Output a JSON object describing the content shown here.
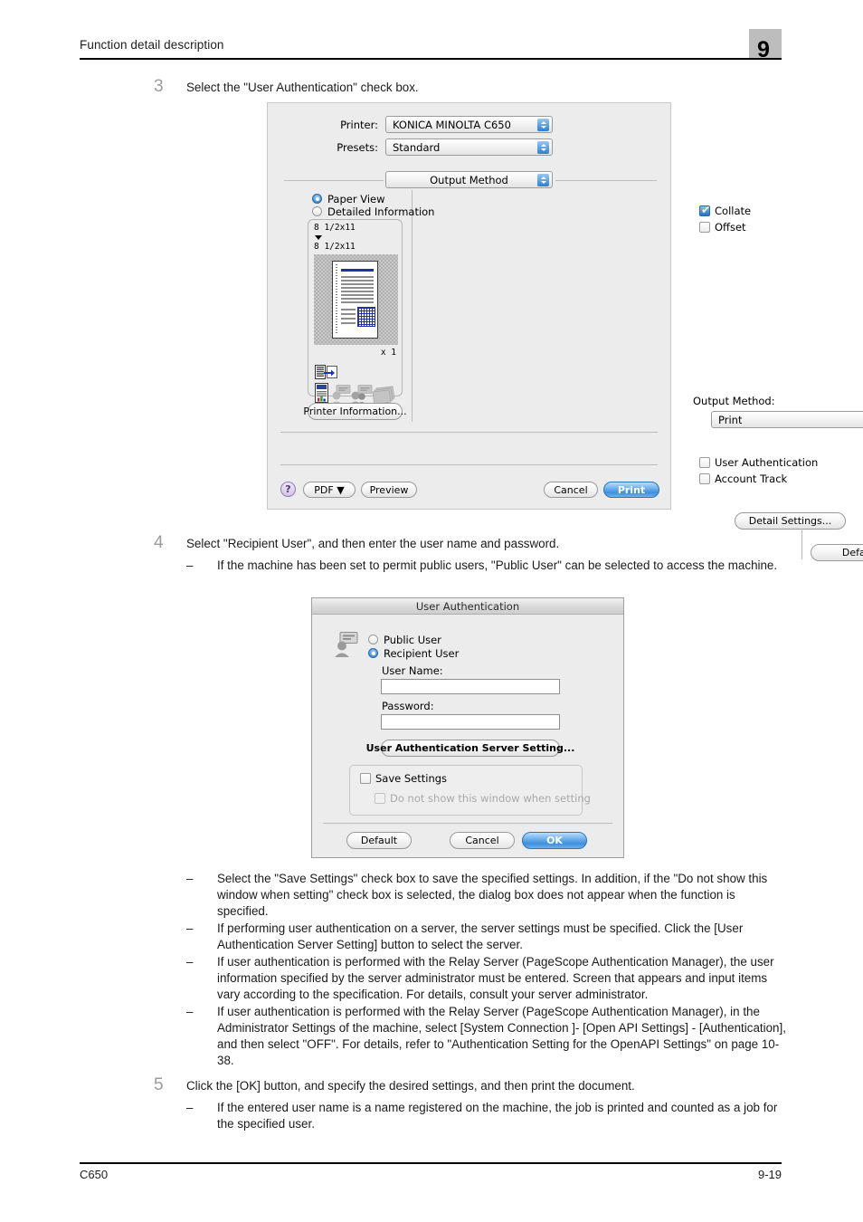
{
  "header": {
    "title": "Function detail description",
    "chapter": "9"
  },
  "footer": {
    "model": "C650",
    "page": "9-19"
  },
  "steps": [
    {
      "num": "3",
      "text": "Select the \"User Authentication\" check box.",
      "bullets": []
    },
    {
      "num": "4",
      "text": "Select \"Recipient User\", and then enter the user name and password.",
      "bullets": [
        "If the machine has been set to permit public users, \"Public User\" can be selected to access the machine."
      ]
    },
    {
      "num": "5",
      "text": "Click the [OK] button, and specify the desired settings, and then print the document.",
      "bullets": [
        "If the entered user name is a name registered on the machine, the job is printed and counted as a job for the specified user."
      ]
    }
  ],
  "notes_after_auth_dialog": [
    "Select the \"Save Settings\" check box to save the specified settings. In addition, if the \"Do not show this window when setting\" check box is selected, the dialog box does not appear when the function is specified.",
    "If performing user authentication on a server, the server settings must be specified. Click the [User Authentication Server Setting] button to select the server.",
    "If user authentication is performed with the Relay Server (PageScope Authentication Manager), the user information specified by the server administrator must be entered. Screen that appears and input items vary according to the specification. For details, consult your server administrator.",
    "If user authentication is performed with the Relay Server (PageScope Authentication Manager), in the Administrator Settings of the machine, select [System Connection ]- [Open API Settings] - [Authentication], and then select \"OFF\". For details, refer to \"Authentication Setting for the OpenAPI Settings\" on page 10-38."
  ],
  "dash": "–",
  "print_dialog": {
    "printer_label": "Printer:",
    "printer_value": "KONICA MINOLTA C650",
    "presets_label": "Presets:",
    "presets_value": "Standard",
    "pane_value": "Output Method",
    "view_radios": [
      {
        "label": "Paper View",
        "selected": true
      },
      {
        "label": "Detailed Information",
        "selected": false
      }
    ],
    "preview": {
      "size_from": "8 1/2x11",
      "size_to": "8 1/2x11",
      "copies": "x 1"
    },
    "printer_information_button": "Printer Information...",
    "checkboxes_top": [
      {
        "label": "Collate",
        "checked": true
      },
      {
        "label": "Offset",
        "checked": false
      }
    ],
    "output_method_label": "Output Method:",
    "output_method_value": "Print",
    "checkboxes_auth": [
      {
        "label": "User Authentication",
        "checked": false
      },
      {
        "label": "Account Track",
        "checked": false
      }
    ],
    "detail_settings_button": "Detail Settings...",
    "default_button": "Default",
    "help_button": "?",
    "pdf_button": "PDF ▼",
    "preview_button": "Preview",
    "cancel_button": "Cancel",
    "print_button": "Print"
  },
  "auth_dialog": {
    "title": "User Authentication",
    "radios": [
      {
        "label": "Public User",
        "selected": false
      },
      {
        "label": "Recipient User",
        "selected": true
      }
    ],
    "user_name_label": "User Name:",
    "user_name_value": "",
    "password_label": "Password:",
    "password_value": "",
    "server_setting_button": "User Authentication Server Setting...",
    "save_settings": {
      "label": "Save Settings",
      "checked": false
    },
    "do_not_show": {
      "label": "Do not show this window when setting",
      "checked": false,
      "disabled": true
    },
    "default_button": "Default",
    "cancel_button": "Cancel",
    "ok_button": "OK"
  },
  "colors": {
    "accent_blue": "#3f8ede",
    "chapter_box": "#bdbdbd",
    "step_number": "#9b9b9b",
    "dialog_bg": "#ececec"
  }
}
